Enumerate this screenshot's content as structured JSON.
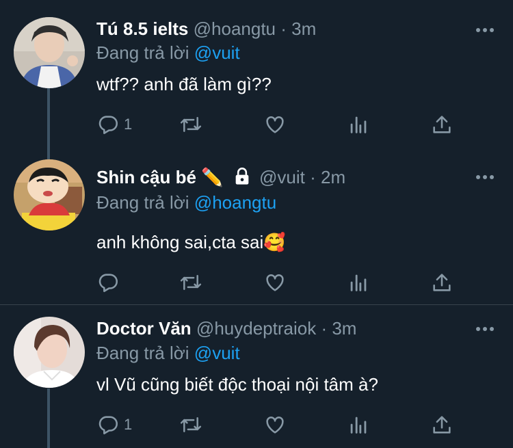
{
  "reply_prefix": "Đang trả lời",
  "tweets": [
    {
      "name": "Tú 8.5 ielts",
      "handle": "@hoangtu",
      "dot": "·",
      "time": "3m",
      "reply_to": "@vuit",
      "text": "wtf?? anh đã làm gì??",
      "reply_count": "1",
      "name_emoji": "",
      "avatar_icon": "avatar-photo"
    },
    {
      "name": "Shin cậu bé",
      "name_emoji": "✏️",
      "protected_icon": "lock-icon",
      "handle": "@vuit",
      "dot": "·",
      "time": "2m",
      "reply_to": "@hoangtu",
      "text": "anh không sai,cta sai🥰",
      "reply_count": "",
      "avatar_icon": "cartoon-avatar"
    },
    {
      "name": "Doctor Văn",
      "handle": "@huydeptraiok",
      "dot": "·",
      "time": "3m",
      "reply_to": "@vuit",
      "text": "vl Vũ cũng biết độc thoại nội tâm à?",
      "reply_count": "1",
      "name_emoji": "",
      "avatar_icon": "avatar-photo"
    }
  ],
  "colors": {
    "background": "#15202b",
    "text": "#ffffff",
    "muted": "#8899a6",
    "link": "#1da1f2",
    "divider": "#38444d",
    "thread_line": "#3d5466"
  }
}
